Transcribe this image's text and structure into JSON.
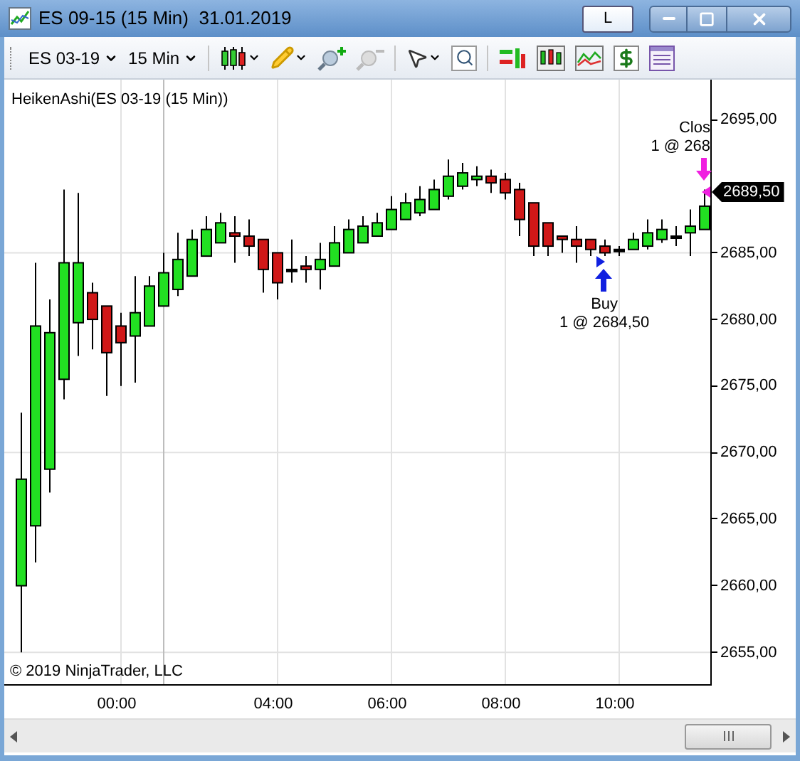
{
  "window": {
    "title": "ES 09-15 (15 Min)  31.01.2019",
    "buttons": [
      "L"
    ]
  },
  "toolbar": {
    "instrument": "ES 03-19",
    "interval": "15 Min"
  },
  "chart": {
    "indicator_label": "HeikenAshi(ES 03-19 (15 Min))",
    "copyright": "© 2019 NinjaTrader, LLC",
    "price_marker": "2689,50",
    "session_time_label": "00:00",
    "trades": [
      {
        "kind": "sell",
        "lines": [
          "Clos",
          "1 @ 268"
        ]
      },
      {
        "kind": "buy",
        "lines": [
          "Buy",
          "1 @ 2684,50"
        ]
      }
    ],
    "chart_data": {
      "type": "candlestick",
      "x": [
        -0.5,
        -0.25,
        0,
        0.25,
        0.5,
        0.75,
        1,
        1.25,
        1.5,
        1.75,
        2,
        2.25,
        2.5,
        2.75,
        3,
        3.25,
        3.5,
        3.75,
        4,
        4.25,
        4.5,
        4.75,
        5,
        5.25,
        5.5,
        5.75,
        6,
        6.25,
        6.5,
        6.75,
        7,
        7.25,
        7.5,
        7.75,
        8,
        8.25,
        8.5,
        8.75,
        9,
        9.25,
        9.5,
        9.75,
        10,
        10.25,
        10.5,
        10.75,
        11,
        11.25,
        11.5
      ],
      "ohlc": [
        [
          2660,
          2673,
          2655,
          2668
        ],
        [
          2664.5,
          2684.25,
          2661.75,
          2679.5
        ],
        [
          2668.75,
          2681.5,
          2667,
          2679
        ],
        [
          2675.5,
          2689.75,
          2674,
          2684.25
        ],
        [
          2679.75,
          2689.5,
          2677.25,
          2684.25
        ],
        [
          2682,
          2682.75,
          2677.75,
          2680
        ],
        [
          2681,
          2681,
          2674.25,
          2677.5
        ],
        [
          2679.5,
          2680.5,
          2675,
          2678.25
        ],
        [
          2678.75,
          2683.25,
          2675.25,
          2680.5
        ],
        [
          2679.5,
          2683.25,
          2679.5,
          2682.5
        ],
        [
          2681,
          2685,
          2681,
          2683.5
        ],
        [
          2682.25,
          2686.5,
          2681.75,
          2684.5
        ],
        [
          2683.25,
          2686.75,
          2683.25,
          2686
        ],
        [
          2684.75,
          2687.75,
          2684.75,
          2686.75
        ],
        [
          2685.75,
          2688,
          2685.75,
          2687.25
        ],
        [
          2686.5,
          2687.75,
          2684.25,
          2686.25
        ],
        [
          2686.25,
          2687.5,
          2684.75,
          2685.5
        ],
        [
          2686,
          2686,
          2682,
          2683.75
        ],
        [
          2685,
          2685,
          2681.5,
          2682.75
        ],
        [
          2683.75,
          2686,
          2682.75,
          2683.75
        ],
        [
          2684,
          2684.75,
          2682.75,
          2683.75
        ],
        [
          2683.75,
          2685.75,
          2682.25,
          2684.5
        ],
        [
          2684,
          2687,
          2684,
          2685.75
        ],
        [
          2685,
          2687.5,
          2685,
          2686.75
        ],
        [
          2685.75,
          2687.75,
          2685.75,
          2687
        ],
        [
          2686.25,
          2688,
          2686.25,
          2687.25
        ],
        [
          2686.75,
          2689.25,
          2686.75,
          2688.25
        ],
        [
          2687.5,
          2689.5,
          2687.5,
          2688.75
        ],
        [
          2688,
          2690,
          2687.75,
          2689
        ],
        [
          2688.25,
          2690.5,
          2688.25,
          2689.75
        ],
        [
          2689.25,
          2692,
          2689,
          2690.75
        ],
        [
          2690,
          2691.75,
          2689.75,
          2691
        ],
        [
          2690.5,
          2691.5,
          2690,
          2690.75
        ],
        [
          2690.75,
          2691.25,
          2689.5,
          2690.25
        ],
        [
          2690.5,
          2691,
          2689,
          2689.5
        ],
        [
          2689.75,
          2690.25,
          2686.25,
          2687.5
        ],
        [
          2688.75,
          2688.75,
          2684.75,
          2685.5
        ],
        [
          2687.25,
          2687.25,
          2684.75,
          2685.5
        ],
        [
          2686.25,
          2686.25,
          2685,
          2686
        ],
        [
          2686,
          2687,
          2684.25,
          2685.5
        ],
        [
          2686,
          2686,
          2684.75,
          2685.25
        ],
        [
          2685.5,
          2686,
          2684.75,
          2685
        ],
        [
          2685.25,
          2685.5,
          2684.75,
          2685.25
        ],
        [
          2685.25,
          2686.5,
          2685.25,
          2686
        ],
        [
          2685.5,
          2687.5,
          2685.25,
          2686.5
        ],
        [
          2686,
          2687.5,
          2685.75,
          2686.75
        ],
        [
          2686.25,
          2687,
          2685.5,
          2686.25
        ],
        [
          2686.5,
          2688.25,
          2684.75,
          2687
        ],
        [
          2686.75,
          2689.75,
          2686.75,
          2688.5
        ]
      ],
      "ylim": [
        2652.5,
        2698
      ],
      "yticks": [
        {
          "value": 2695,
          "label": "2695,00"
        },
        {
          "value": 2685,
          "label": "2685,00"
        },
        {
          "value": 2680,
          "label": "2680,00"
        },
        {
          "value": 2675,
          "label": "2675,00"
        },
        {
          "value": 2670,
          "label": "2670,00"
        },
        {
          "value": 2665,
          "label": "2665,00"
        },
        {
          "value": 2660,
          "label": "2660,00"
        },
        {
          "value": 2655,
          "label": "2655,00"
        }
      ],
      "xlim": [
        -0.8,
        11.6
      ],
      "grid": true,
      "ref_lines": [
        {
          "axis": "x",
          "value": 2
        }
      ],
      "xticks": [
        {
          "value": 4,
          "label": "04:00"
        },
        {
          "value": 6,
          "label": "06:00"
        },
        {
          "value": 8,
          "label": "08:00"
        },
        {
          "value": 10,
          "label": "10:00"
        }
      ]
    }
  }
}
